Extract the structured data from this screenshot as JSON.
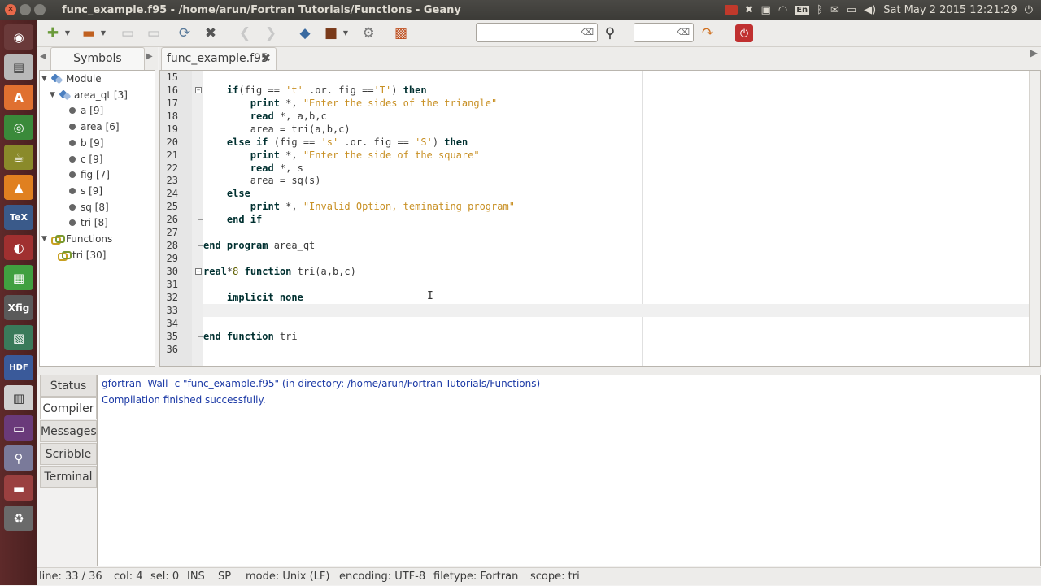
{
  "window": {
    "title": "func_example.f95 - /home/arun/Fortran Tutorials/Functions - Geany"
  },
  "tray": {
    "lang": "En",
    "datetime": "Sat May  2 2015 12:21:29"
  },
  "sidebar": {
    "tab": "Symbols",
    "tree": [
      {
        "label": "Module",
        "kind": "module",
        "level": 0
      },
      {
        "label": "area_qt [3]",
        "kind": "module",
        "level": 1
      },
      {
        "label": "a [9]",
        "kind": "var",
        "level": 2
      },
      {
        "label": "area [6]",
        "kind": "var",
        "level": 2
      },
      {
        "label": "b [9]",
        "kind": "var",
        "level": 2
      },
      {
        "label": "c [9]",
        "kind": "var",
        "level": 2
      },
      {
        "label": "fig [7]",
        "kind": "var",
        "level": 2
      },
      {
        "label": "s [9]",
        "kind": "var",
        "level": 2
      },
      {
        "label": "sq [8]",
        "kind": "var",
        "level": 2
      },
      {
        "label": "tri [8]",
        "kind": "var",
        "level": 2
      },
      {
        "label": "Functions",
        "kind": "function",
        "level": 0
      },
      {
        "label": "tri [30]",
        "kind": "function",
        "level": 1
      }
    ]
  },
  "editor": {
    "tab": "func_example.f95",
    "current_line": 33,
    "lines": [
      {
        "n": "15",
        "html": ""
      },
      {
        "n": "16",
        "html": "    <span class='kw'>if</span>(fig == <span class='str'>'t'</span> .or. fig ==<span class='str'>'T'</span>) <span class='kw'>then</span>"
      },
      {
        "n": "17",
        "html": "        <span class='kw'>print</span> *, <span class='str'>\"Enter the sides of the triangle\"</span>"
      },
      {
        "n": "18",
        "html": "        <span class='kw'>read</span> *, a,b,c"
      },
      {
        "n": "19",
        "html": "        area = tri(a,b,c)"
      },
      {
        "n": "20",
        "html": "    <span class='kw'>else if</span> (fig == <span class='str'>'s'</span> .or. fig == <span class='str'>'S'</span>) <span class='kw'>then</span>"
      },
      {
        "n": "21",
        "html": "        <span class='kw'>print</span> *, <span class='str'>\"Enter the side of the square\"</span>"
      },
      {
        "n": "22",
        "html": "        <span class='kw'>read</span> *, s"
      },
      {
        "n": "23",
        "html": "        area = sq(s)"
      },
      {
        "n": "24",
        "html": "    <span class='kw'>else</span>"
      },
      {
        "n": "25",
        "html": "        <span class='kw'>print</span> *, <span class='str'>\"Invalid Option, teminating program\"</span>"
      },
      {
        "n": "26",
        "html": "    <span class='kw'>end if</span>"
      },
      {
        "n": "27",
        "html": ""
      },
      {
        "n": "28",
        "html": "<span class='kw'>end program</span> area_qt"
      },
      {
        "n": "29",
        "html": ""
      },
      {
        "n": "30",
        "html": "<span class='kw'>real</span>*<span class='num'>8</span> <span class='kw'>function</span> tri(a,b,c)"
      },
      {
        "n": "31",
        "html": ""
      },
      {
        "n": "32",
        "html": "    <span class='kw'>implicit none</span>"
      },
      {
        "n": "33",
        "html": ""
      },
      {
        "n": "34",
        "html": ""
      },
      {
        "n": "35",
        "html": "<span class='kw'>end function</span> tri"
      },
      {
        "n": "36",
        "html": ""
      }
    ]
  },
  "messages": {
    "tabs": [
      "Status",
      "Compiler",
      "Messages",
      "Scribble",
      "Terminal"
    ],
    "active_tab": "Compiler",
    "lines": [
      "gfortran -Wall -c \"func_example.f95\" (in directory: /home/arun/Fortran Tutorials/Functions)",
      "Compilation finished successfully."
    ]
  },
  "status": {
    "line": "line: 33 / 36",
    "col": "col: 4",
    "sel": "sel: 0",
    "ins": "INS",
    "sp": "SP",
    "mode": "mode: Unix (LF)",
    "encoding": "encoding: UTF-8",
    "filetype": "filetype: Fortran",
    "scope": "scope: tri"
  }
}
